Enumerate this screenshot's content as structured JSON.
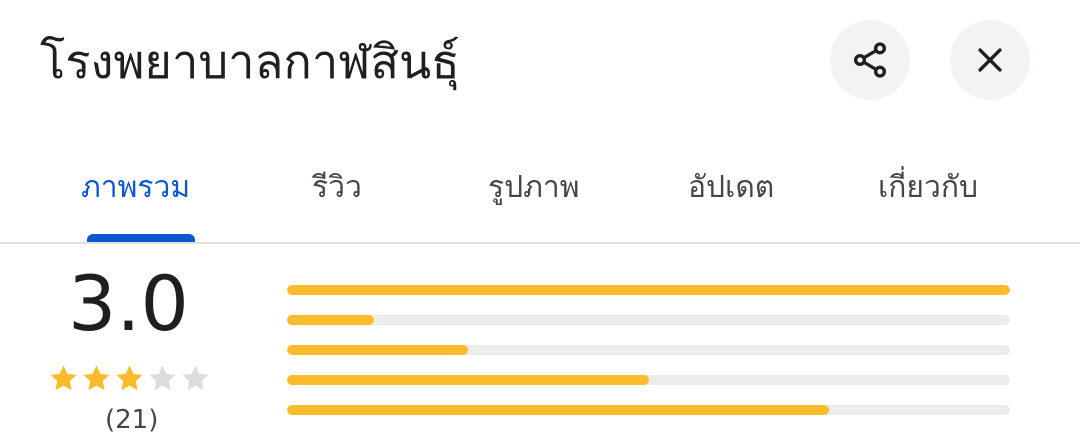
{
  "header": {
    "title": "โรงพยาบาลกาฬสินธุ์"
  },
  "tabs": [
    {
      "label": "ภาพรวม",
      "active": true
    },
    {
      "label": "รีวิว"
    },
    {
      "label": "รูปภาพ"
    },
    {
      "label": "อัปเดต"
    },
    {
      "label": "เกี่ยวกับ"
    }
  ],
  "rating": {
    "score": "3.0",
    "stars_filled": 3,
    "stars_total": 5,
    "count": "(21)",
    "distribution": [
      {
        "stars": 5,
        "fraction": 1.0
      },
      {
        "stars": 4,
        "fraction": 0.12
      },
      {
        "stars": 3,
        "fraction": 0.25
      },
      {
        "stars": 2,
        "fraction": 0.5
      },
      {
        "stars": 1,
        "fraction": 0.75
      }
    ]
  },
  "icons": {
    "share": "share-icon",
    "close": "close-icon",
    "star": "star-icon"
  },
  "colors": {
    "accent": "#0b57d0",
    "star": "#fbbc2b",
    "bar_bg": "#ececec",
    "star_empty": "#dadce0"
  }
}
